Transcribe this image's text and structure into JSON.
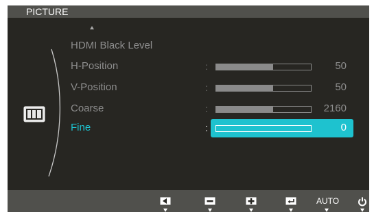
{
  "header": {
    "title": "PICTURE"
  },
  "menu": {
    "items": [
      {
        "label": "HDMI Black Level",
        "value": null,
        "level": null
      },
      {
        "label": "H-Position",
        "value": "50",
        "level": 0.6
      },
      {
        "label": "V-Position",
        "value": "50",
        "level": 0.6
      },
      {
        "label": "Coarse",
        "value": "2160",
        "level": 0.6
      },
      {
        "label": "Fine",
        "value": "0",
        "level": 0.0,
        "selected": true
      }
    ],
    "colon": ":"
  },
  "footer": {
    "buttons": [
      {
        "name": "left-arrow-button",
        "icon": "left-arrow-icon"
      },
      {
        "name": "minus-button",
        "icon": "minus-icon"
      },
      {
        "name": "plus-button",
        "icon": "plus-icon"
      },
      {
        "name": "enter-button",
        "icon": "enter-icon"
      },
      {
        "name": "auto-button",
        "label": "AUTO"
      },
      {
        "name": "power-button",
        "icon": "power-icon"
      }
    ]
  },
  "colors": {
    "accent": "#1ec2cf",
    "panel": "#272622",
    "bars": "#50504c",
    "text": "#8d8d8d"
  }
}
